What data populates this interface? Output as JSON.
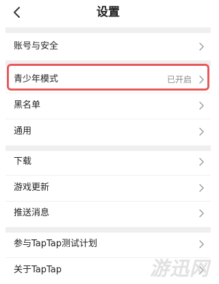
{
  "header": {
    "title": "设置",
    "back_icon": "chevron-left-icon"
  },
  "sections": [
    {
      "items": [
        {
          "label": "账号与安全",
          "value": ""
        }
      ]
    },
    {
      "items": [
        {
          "label": "青少年模式",
          "value": "已开启",
          "highlighted": true
        },
        {
          "label": "黑名单",
          "value": ""
        },
        {
          "label": "通用",
          "value": ""
        }
      ]
    },
    {
      "items": [
        {
          "label": "下载",
          "value": ""
        },
        {
          "label": "游戏更新",
          "value": ""
        },
        {
          "label": "推送消息",
          "value": ""
        }
      ]
    },
    {
      "items": [
        {
          "label": "参与TapTap测试计划",
          "value": ""
        },
        {
          "label": "关于TapTap",
          "value": ""
        }
      ]
    }
  ],
  "watermark": "游迅网",
  "colors": {
    "highlight": "#e8585b",
    "divider": "#efefef",
    "secondary_text": "#888888"
  }
}
